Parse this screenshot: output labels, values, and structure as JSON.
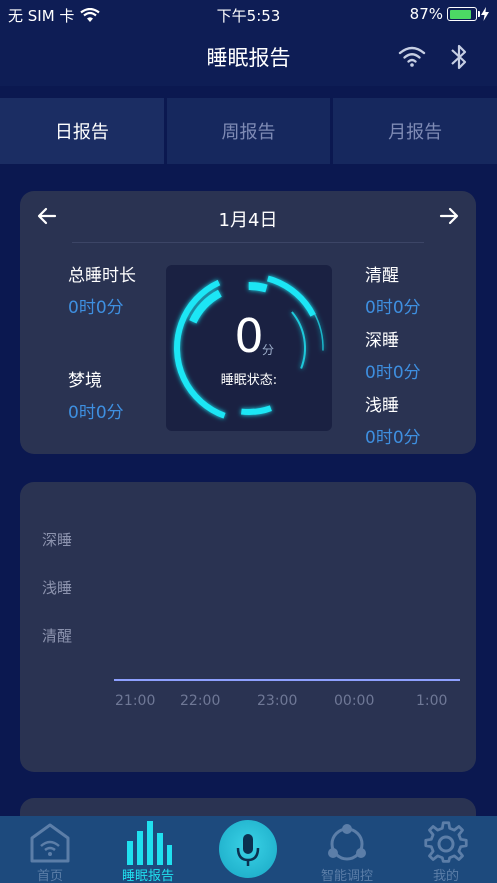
{
  "status_bar": {
    "carrier": "无 SIM 卡",
    "time": "下午5:53",
    "battery": "87%",
    "battery_level": 0.87
  },
  "nav": {
    "title": "睡眠报告",
    "wifi_icon": "wifi-icon",
    "bluetooth_icon": "bluetooth-icon"
  },
  "tabs": [
    {
      "label": "日报告",
      "active": true
    },
    {
      "label": "周报告",
      "active": false
    },
    {
      "label": "月报告",
      "active": false
    }
  ],
  "summary": {
    "date": "1月4日",
    "total_sleep": {
      "label": "总睡时长",
      "value": "0时0分"
    },
    "dream": {
      "label": "梦境",
      "value": "0时0分"
    },
    "awake": {
      "label": "清醒",
      "value": "0时0分"
    },
    "deep": {
      "label": "深睡",
      "value": "0时0分"
    },
    "light": {
      "label": "浅睡",
      "value": "0时0分"
    },
    "score": {
      "value": "0",
      "unit": "分",
      "status_label": "睡眠状态:"
    }
  },
  "chart_data": {
    "type": "line",
    "y_categories": [
      "深睡",
      "浅睡",
      "清醒"
    ],
    "x": [
      "21:00",
      "22:00",
      "23:00",
      "00:00",
      "1:00"
    ],
    "series": [
      {
        "values": []
      }
    ],
    "grid": false,
    "colors": {
      "line": "#8ea0ff"
    }
  },
  "bottom_nav": [
    {
      "label": "首页",
      "icon": "home-wifi-icon",
      "active": false
    },
    {
      "label": "睡眠报告",
      "icon": "bar-chart-icon",
      "active": true
    },
    {
      "label": "",
      "icon": "microphone-icon",
      "active": false
    },
    {
      "label": "智能调控",
      "icon": "network-icon",
      "active": false
    },
    {
      "label": "我的",
      "icon": "gear-icon",
      "active": false
    }
  ],
  "colors": {
    "background": "#0b1850",
    "card": "#2a3352",
    "accent": "#20e0ef",
    "value_blue": "#3e8fe0"
  }
}
